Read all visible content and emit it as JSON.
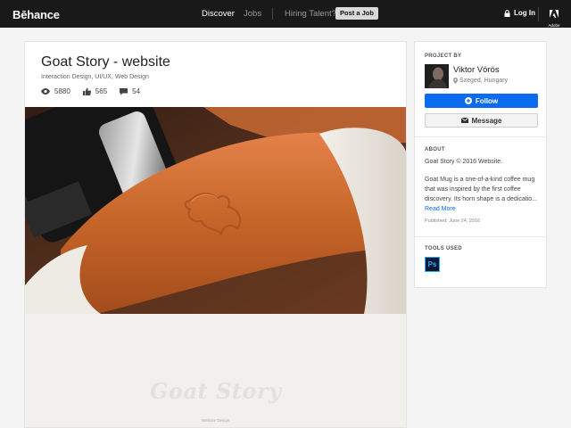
{
  "topbar": {
    "logo": "Bēhance",
    "nav": {
      "discover": "Discover",
      "jobs": "Jobs",
      "hiring": "Hiring Talent?"
    },
    "post_job": "Post a Job",
    "login": "Log In",
    "adobe": "Adobe"
  },
  "project": {
    "title": "Goat Story - website",
    "fields": "Interaction Design, UI/UX, Web Design",
    "stats": {
      "views": "5880",
      "appreciations": "565",
      "comments": "54"
    },
    "wordmark": "Goat Story",
    "wordmark_caption": "Website Design"
  },
  "sidebar": {
    "project_by_label": "PROJECT BY",
    "owner_name": "Viktor Vörös",
    "owner_location": "Szeged, Hungary",
    "follow_label": "Follow",
    "message_label": "Message",
    "about_label": "ABOUT",
    "about_title": "Goat Story © 2016 Website.",
    "about_desc": "Goat Mug is a one-of-a-kind coffee mug that was inspired by the first coffee discovery. Its horn shape is a dedicatio...",
    "read_more": "Read More",
    "published": "Published: June 24, 2016",
    "tools_label": "TOOLS USED",
    "tool_ps": "Ps"
  },
  "colors": {
    "accent": "#0a6bef",
    "topbar": "#191919",
    "leather": "#c8672a"
  }
}
